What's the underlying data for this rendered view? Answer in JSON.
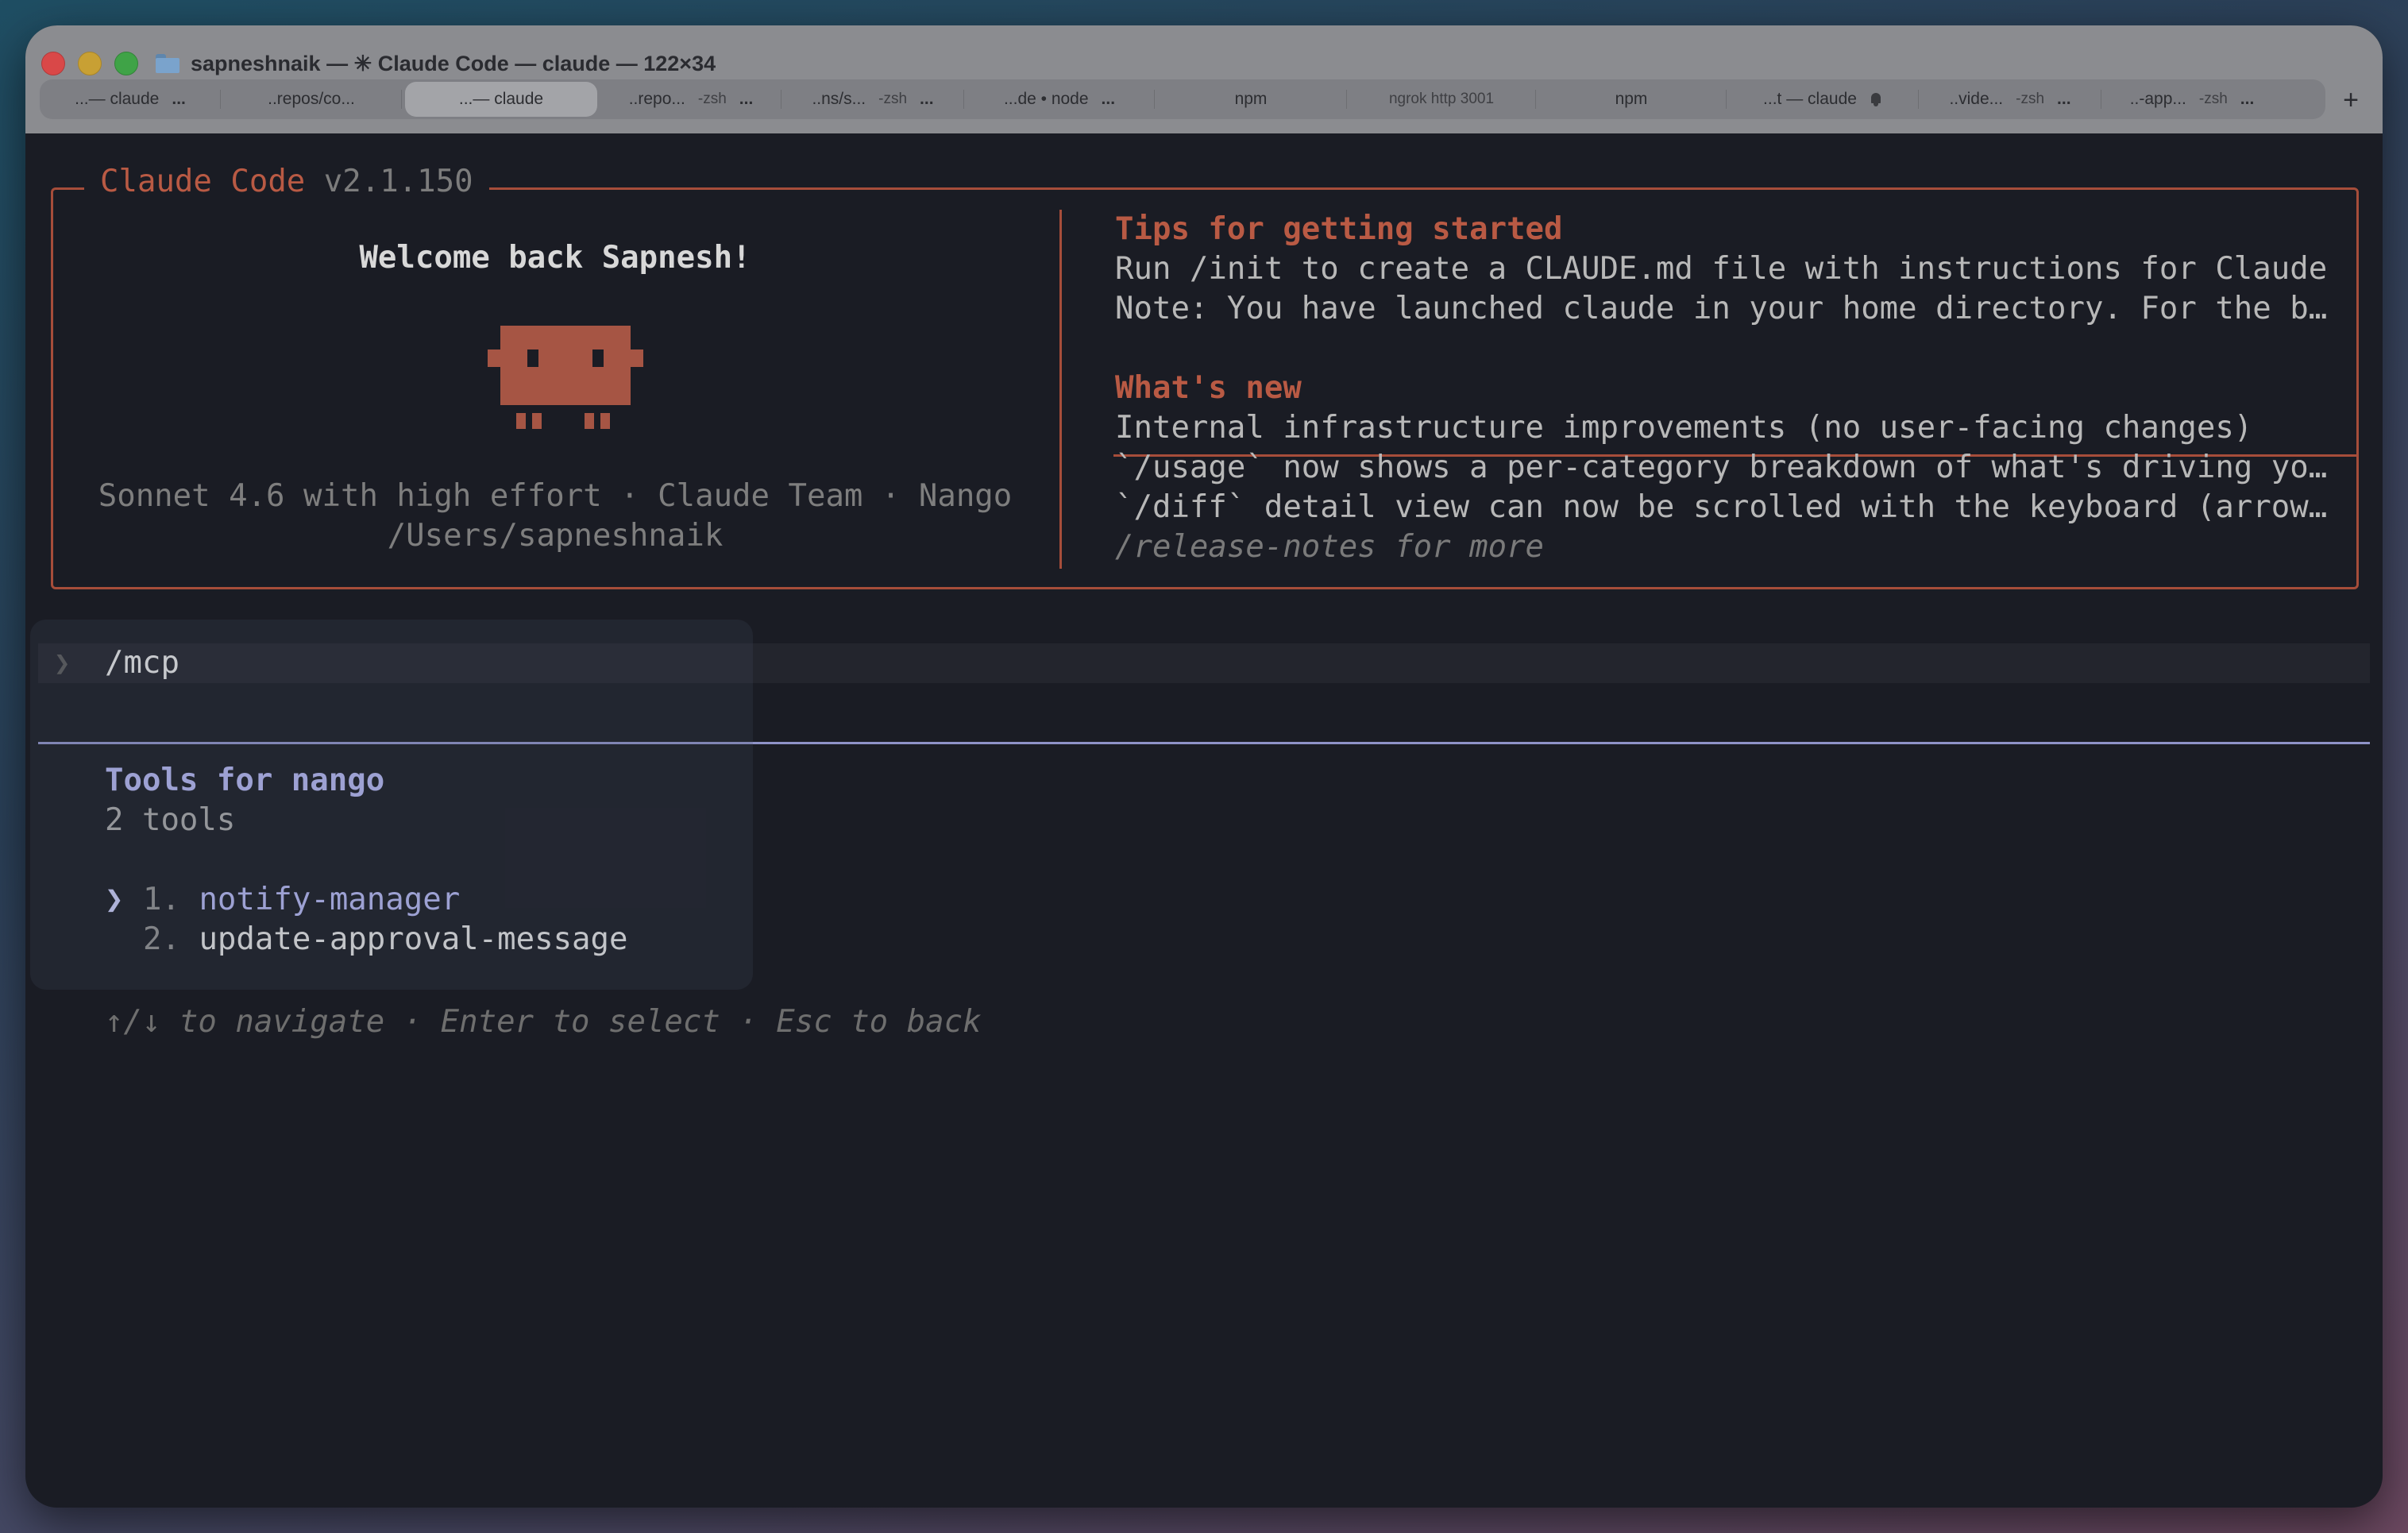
{
  "window": {
    "title": "sapneshnaik — ✳ Claude Code — claude — 122×34"
  },
  "tabs": [
    {
      "label": "...— claude",
      "extra": "",
      "dots": "..."
    },
    {
      "label": "..repos/co...",
      "extra": "",
      "dots": ""
    },
    {
      "label": "...— claude",
      "extra": "",
      "dots": "",
      "active": true
    },
    {
      "label": "..repo...",
      "extra": "-zsh",
      "dots": "..."
    },
    {
      "label": "..ns/s...",
      "extra": "-zsh",
      "dots": "..."
    },
    {
      "label": "...de • node",
      "extra": "",
      "dots": "..."
    },
    {
      "label": "npm",
      "extra": "",
      "dots": ""
    },
    {
      "label": "ngrok http 3001",
      "extra": "",
      "dots": ""
    },
    {
      "label": "npm",
      "extra": "",
      "dots": ""
    },
    {
      "label": "...t — claude",
      "extra": "",
      "dots": ""
    },
    {
      "label": "..vide...",
      "extra": "-zsh",
      "dots": "..."
    },
    {
      "label": "..-app...",
      "extra": "-zsh",
      "dots": "..."
    }
  ],
  "new_tab_label": "+",
  "welcome": {
    "app_name": "Claude Code",
    "version": "v2.1.150",
    "greeting": "Welcome back Sapnesh!",
    "model_line": "Sonnet 4.6 with high effort · Claude Team · Nango",
    "path": "/Users/sapneshnaik"
  },
  "tips": {
    "heading": "Tips for getting started",
    "lines": [
      "Run /init to create a CLAUDE.md file with instructions for Claude",
      "Note: You have launched claude in your home directory. For the b…"
    ]
  },
  "whats_new": {
    "heading": "What's new",
    "lines": [
      "Internal infrastructure improvements (no user-facing changes)",
      "`/usage` now shows a per-category breakdown of what's driving yo…",
      "`/diff` detail view can now be scrolled with the keyboard (arrow…"
    ],
    "more": "/release-notes for more"
  },
  "prompt": {
    "chevron": "❯",
    "command": "/mcp"
  },
  "mcp_panel": {
    "title": "Tools for nango",
    "count": "2 tools",
    "selector": "❯",
    "tools": [
      {
        "number": "1.",
        "name": "notify-manager",
        "selected": true
      },
      {
        "number": "2.",
        "name": "update-approval-message",
        "selected": false
      }
    ],
    "help": "↑/↓ to navigate · Enter to select · Esc to back"
  },
  "colors": {
    "accent_orange": "#b95a44",
    "accent_periwinkle": "#b3b6ef",
    "terminal_bg": "#1a1c24"
  }
}
